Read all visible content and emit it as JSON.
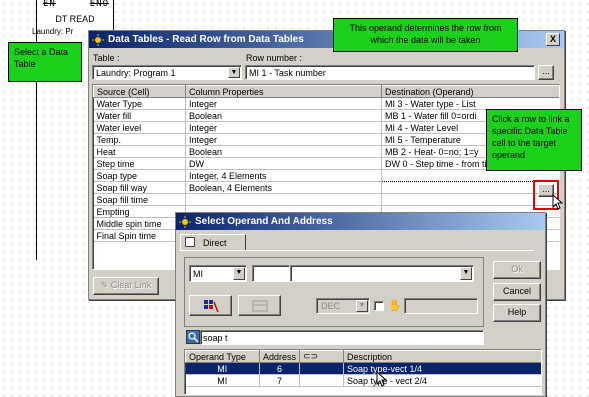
{
  "ladder": {
    "en": "EN",
    "eno": "ENO",
    "block_name": "DT READ",
    "operand_label": "Laundry: Pr"
  },
  "callouts": {
    "select_table": "Select a Data Table",
    "operand_row": "This operand determines the row from which the data will be taken",
    "click_row": "Click a row to link a specific Data Table cell to the target operand"
  },
  "data_tables": {
    "title": "Data Tables - Read Row from Data Tables",
    "close": "X",
    "table_label": "Table :",
    "table_value": "Laundry: Program 1",
    "row_label": "Row number :",
    "row_value": "MI 1 - Task number",
    "row_browse": "...",
    "columns": [
      "Source (Cell)",
      "Column Properties",
      "Destination (Operand)"
    ],
    "rows": [
      [
        "Water Type",
        "Integer",
        "MI 3 - Water type - List"
      ],
      [
        "Water fill",
        "Boolean",
        "MB 1 - Water fill 0=ordi"
      ],
      [
        "Water level",
        "Integer",
        "MI 4 - Water Level"
      ],
      [
        "Temp.",
        "Integer",
        "MI 5 - Temperature"
      ],
      [
        "Heat",
        "Boolean",
        "MB 2 - Heat- 0=no; 1=y"
      ],
      [
        "Step time",
        "DW",
        "DW 0 - Step time - from timer"
      ],
      [
        "Soap type",
        "Integer, 4 Elements",
        ""
      ],
      [
        "Soap fill way",
        "Boolean, 4 Elements",
        ""
      ],
      [
        "Soap fill time",
        "",
        ""
      ],
      [
        "Empting",
        "",
        ""
      ],
      [
        "Middle spin time",
        "",
        ""
      ],
      [
        "Final Spin time",
        "",
        ""
      ]
    ],
    "cell_browse": "...",
    "clear_link": "Clear Link"
  },
  "select_operand": {
    "title": "Select Operand And Address",
    "tab_direct": "Direct",
    "operand_type": "MI",
    "format": "DEC",
    "ok": "Ok",
    "cancel": "Cancel",
    "help": "Help",
    "search_value": "soap t",
    "columns": [
      "Operand Type",
      "Address",
      "",
      "Description"
    ],
    "results": [
      {
        "type": "MI",
        "address": "6",
        "description": "Soap type-vect 1/4",
        "selected": true
      },
      {
        "type": "MI",
        "address": "7",
        "description": "Soap type - vect 2/4",
        "selected": false
      }
    ]
  },
  "colors": {
    "titlebar_start": "#0a246a",
    "titlebar_end": "#a6caf0",
    "callout_green": "#1cd11c",
    "selection": "#0a246a",
    "highlight_red": "#e00000"
  }
}
